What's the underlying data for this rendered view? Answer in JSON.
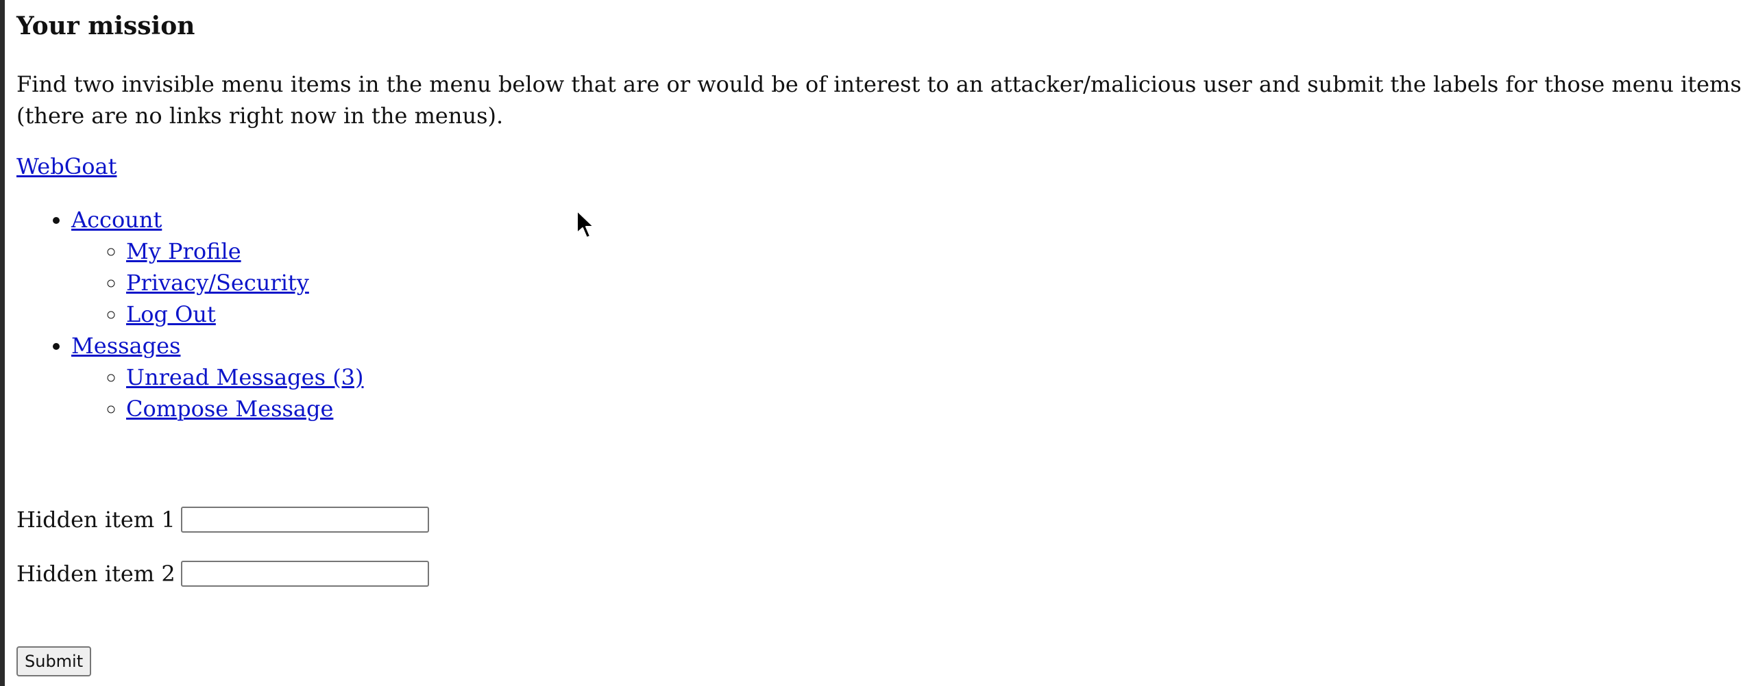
{
  "mission": {
    "title": "Your mission",
    "description": "Find two invisible menu items in the menu below that are or would be of interest to an attacker/malicious user and submit the labels for those menu items (there are no links right now in the menus)."
  },
  "brand": {
    "label": "WebGoat"
  },
  "menu": {
    "sections": [
      {
        "label": "Account",
        "items": [
          "My Profile",
          "Privacy/Security",
          "Log Out"
        ]
      },
      {
        "label": "Messages",
        "items": [
          "Unread Messages (3)",
          "Compose Message"
        ]
      }
    ]
  },
  "form": {
    "hidden_item_1": {
      "label": "Hidden item 1",
      "value": ""
    },
    "hidden_item_2": {
      "label": "Hidden item 2",
      "value": ""
    },
    "submit_label": "Submit"
  }
}
